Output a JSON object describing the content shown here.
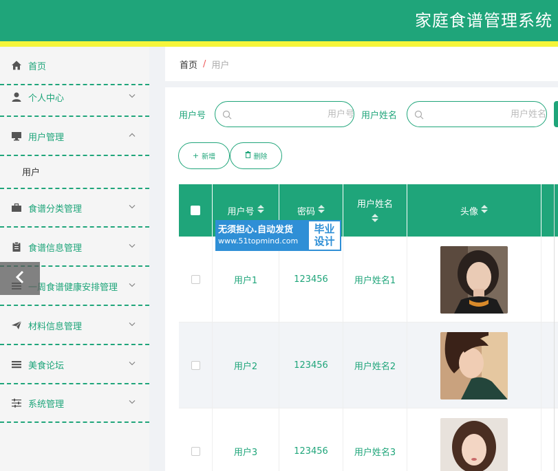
{
  "header": {
    "title": "家庭食谱管理系统"
  },
  "colors": {
    "primary": "#1fa57a",
    "accent_stripe": "#f5f53a",
    "watermark_blue": "#2f8fd6"
  },
  "sidebar": {
    "items": [
      {
        "label": "首页",
        "icon": "home-icon",
        "arrow": ""
      },
      {
        "label": "个人中心",
        "icon": "user-icon",
        "arrow": "⌄"
      },
      {
        "label": "用户管理",
        "icon": "monitor-icon",
        "arrow": "⌃"
      },
      {
        "label": "食谱分类管理",
        "icon": "briefcase-icon",
        "arrow": "⌄"
      },
      {
        "label": "食谱信息管理",
        "icon": "clipboard-icon",
        "arrow": "⌄"
      },
      {
        "label": "一周食谱健康安排管理",
        "icon": "list-icon",
        "arrow": "⌄"
      },
      {
        "label": "材料信息管理",
        "icon": "send-icon",
        "arrow": "⌄"
      },
      {
        "label": "美食论坛",
        "icon": "menu-icon",
        "arrow": "⌄"
      },
      {
        "label": "系统管理",
        "icon": "sliders-icon",
        "arrow": "⌄"
      }
    ],
    "sub_items": [
      {
        "label": "用户"
      }
    ]
  },
  "breadcrumb": {
    "home": "首页",
    "separator": "/",
    "current": "用户"
  },
  "search": {
    "username_label": "用户号",
    "username_placeholder": "用户号",
    "realname_label": "用户姓名",
    "realname_placeholder": "用户姓名"
  },
  "actions": {
    "add_label": "新增",
    "delete_label": "删除"
  },
  "table": {
    "headers": {
      "username": "用户号",
      "password": "密码",
      "realname": "用户姓名",
      "avatar": "头像"
    },
    "rows": [
      {
        "username": "用户1",
        "password": "123456",
        "realname": "用户姓名1"
      },
      {
        "username": "用户2",
        "password": "123456",
        "realname": "用户姓名2"
      },
      {
        "username": "用户3",
        "password": "123456",
        "realname": "用户姓名3"
      }
    ]
  },
  "watermark": {
    "line1": "无须担心.自动发货",
    "line2": "www.51topmind.com",
    "badge_line1": "毕业",
    "badge_line2": "设计"
  }
}
